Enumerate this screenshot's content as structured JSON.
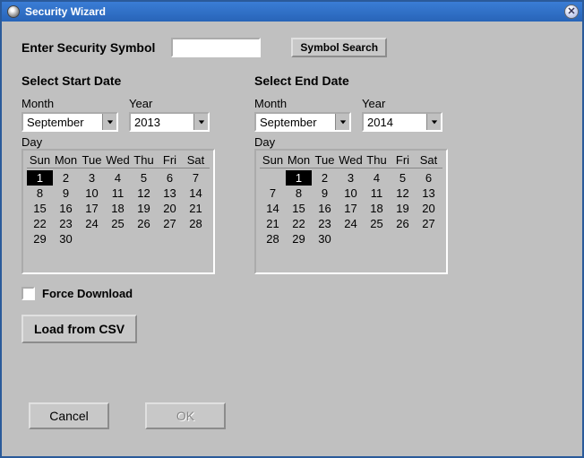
{
  "titlebar": {
    "title": "Security Wizard"
  },
  "symbolRow": {
    "label": "Enter Security Symbol",
    "value": "",
    "searchButton": "Symbol Search"
  },
  "startDate": {
    "title": "Select Start Date",
    "monthLabel": "Month",
    "yearLabel": "Year",
    "dayLabel": "Day",
    "month": "September",
    "year": "2013",
    "selectedDay": 1,
    "dayHeaders": [
      "Sun",
      "Mon",
      "Tue",
      "Wed",
      "Thu",
      "Fri",
      "Sat"
    ],
    "weeks": [
      [
        1,
        2,
        3,
        4,
        5,
        6,
        7
      ],
      [
        8,
        9,
        10,
        11,
        12,
        13,
        14
      ],
      [
        15,
        16,
        17,
        18,
        19,
        20,
        21
      ],
      [
        22,
        23,
        24,
        25,
        26,
        27,
        28
      ],
      [
        29,
        30,
        null,
        null,
        null,
        null,
        null
      ]
    ]
  },
  "endDate": {
    "title": "Select End Date",
    "monthLabel": "Month",
    "yearLabel": "Year",
    "dayLabel": "Day",
    "month": "September",
    "year": "2014",
    "selectedDay": 1,
    "dayHeaders": [
      "Sun",
      "Mon",
      "Tue",
      "Wed",
      "Thu",
      "Fri",
      "Sat"
    ],
    "weeks": [
      [
        null,
        1,
        2,
        3,
        4,
        5,
        6
      ],
      [
        7,
        8,
        9,
        10,
        11,
        12,
        13
      ],
      [
        14,
        15,
        16,
        17,
        18,
        19,
        20
      ],
      [
        21,
        22,
        23,
        24,
        25,
        26,
        27
      ],
      [
        28,
        29,
        30,
        null,
        null,
        null,
        null
      ]
    ]
  },
  "forceDownload": {
    "label": "Force Download",
    "checked": false
  },
  "loadCsv": {
    "label": "Load from CSV"
  },
  "buttons": {
    "cancel": "Cancel",
    "ok": "OK",
    "okEnabled": false
  }
}
